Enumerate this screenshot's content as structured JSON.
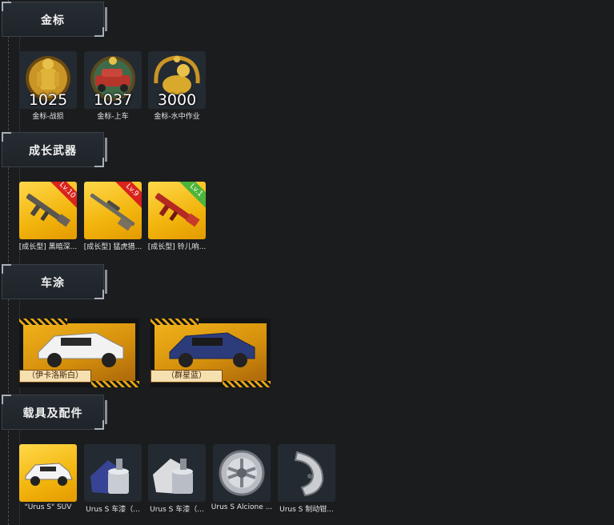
{
  "sections": {
    "gold": {
      "title": "金标",
      "items": [
        {
          "count": "1025",
          "caption": "金标-战损",
          "icon": "soldier-medal-icon"
        },
        {
          "count": "1037",
          "caption": "金标-上车",
          "icon": "car-medal-icon"
        },
        {
          "count": "3000",
          "caption": "金标-水中作业",
          "icon": "seal-medal-icon"
        }
      ]
    },
    "weapons": {
      "title": "成长武器",
      "items": [
        {
          "level": "Lv.10",
          "caption": "[成长型] 黑暗深...",
          "level_color": "red"
        },
        {
          "level": "Lv.9",
          "caption": "[成长型] 猛虎猎...",
          "level_color": "red"
        },
        {
          "level": "Lv.1",
          "caption": "[成长型] 铃儿响...",
          "level_color": "green"
        }
      ]
    },
    "vehicles": {
      "title": "车涂",
      "items": [
        {
          "name": "（伊卡洛斯白）",
          "car_color": "#f2f2f2"
        },
        {
          "name": "（群星蓝）",
          "car_color": "#2c3c7a"
        }
      ]
    },
    "parts": {
      "title": "载具及配件",
      "items": [
        {
          "caption": "\"Urus S\" SUV",
          "icon": "suv-icon"
        },
        {
          "caption": "Urus S 车漆（...",
          "icon": "paint-can-blue-icon"
        },
        {
          "caption": "Urus S 车漆（...",
          "icon": "paint-can-white-icon"
        },
        {
          "caption": "Urus S Alcione ...",
          "icon": "wheel-rim-icon"
        },
        {
          "caption": "Urus S 制动钳...",
          "icon": "brake-caliper-icon"
        }
      ]
    }
  },
  "colors": {
    "background": "#1b1c1e",
    "card": "#242a31",
    "gold": "#f2b40c",
    "level_red": "#d8231c",
    "level_green": "#4db43a"
  }
}
